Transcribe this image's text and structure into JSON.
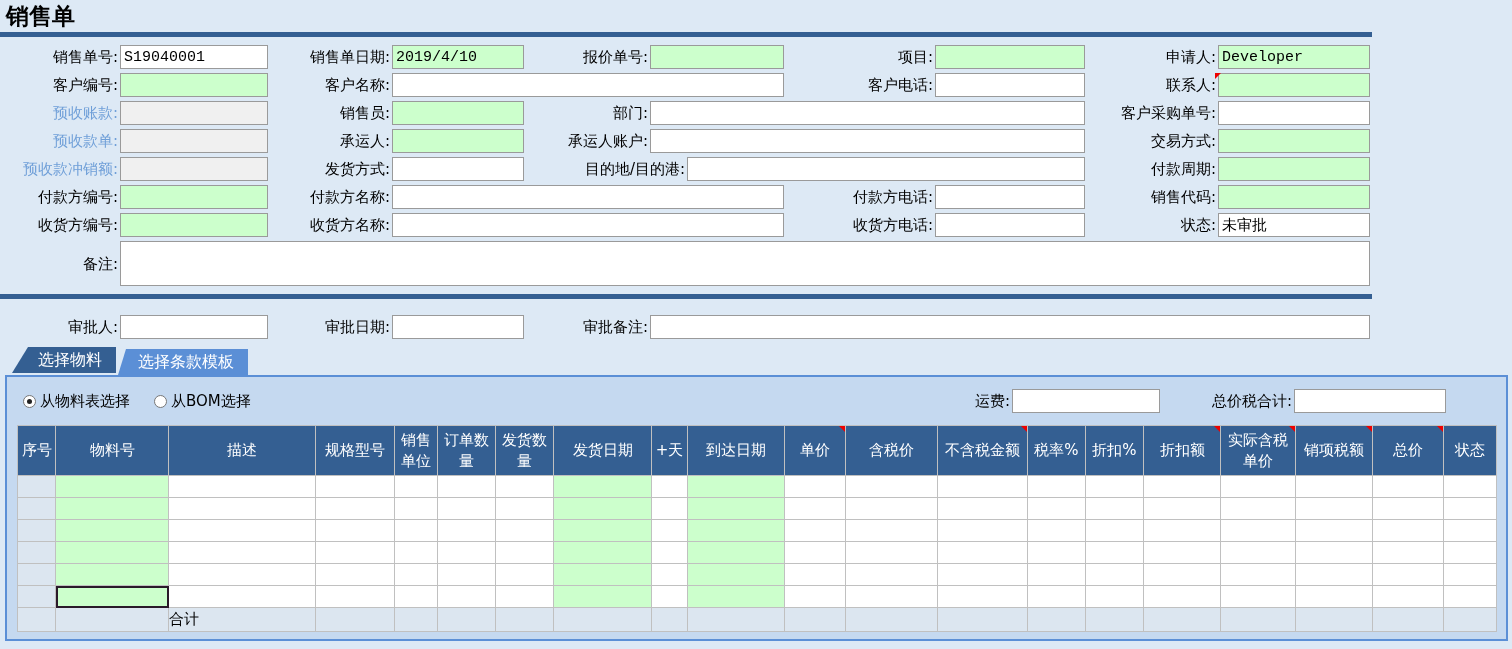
{
  "title": "销售单",
  "form": {
    "rows": [
      [
        {
          "label": "销售单号:",
          "value": "S19040001",
          "kind": "plain",
          "flag": false
        },
        {
          "label": "销售单日期:",
          "value": "2019/4/10",
          "kind": "required",
          "flag": false
        },
        {
          "label": "报价单号:",
          "kind": "required",
          "flag": false
        },
        {
          "label": "项目:",
          "kind": "required",
          "flag": false
        },
        {
          "label": "申请人:",
          "value": "Developer",
          "kind": "required",
          "flag": false
        }
      ],
      [
        {
          "label": "客户编号:",
          "kind": "required",
          "flag": false
        },
        {
          "label": "客户名称:",
          "kind": "plain",
          "flag": false
        },
        {
          "label": "客户电话:",
          "kind": "plain",
          "flag": false
        },
        {
          "label": "联系人:",
          "kind": "required",
          "flag": true
        }
      ],
      [
        {
          "label": "预收账款:",
          "kind": "readonly",
          "flag": false
        },
        {
          "label": "销售员:",
          "kind": "required",
          "flag": false
        },
        {
          "label": "部门:",
          "kind": "plain",
          "flag": false
        },
        {
          "label": "客户采购单号:",
          "kind": "plain",
          "flag": false
        }
      ],
      [
        {
          "label": "预收款单:",
          "kind": "readonly",
          "flag": false
        },
        {
          "label": "承运人:",
          "kind": "required",
          "flag": false
        },
        {
          "label": "承运人账户:",
          "kind": "plain",
          "flag": false
        },
        {
          "label": "交易方式:",
          "kind": "required",
          "flag": false
        }
      ],
      [
        {
          "label": "预收款冲销额:",
          "kind": "readonly",
          "flag": false
        },
        {
          "label": "发货方式:",
          "kind": "plain",
          "flag": false
        },
        {
          "label": "目的地/目的港:",
          "kind": "plain",
          "flag": false
        },
        {
          "label": "付款周期:",
          "kind": "required",
          "flag": false
        }
      ],
      [
        {
          "label": "付款方编号:",
          "kind": "required",
          "flag": false
        },
        {
          "label": "付款方名称:",
          "kind": "plain",
          "flag": false
        },
        {
          "label": "付款方电话:",
          "kind": "plain",
          "flag": false
        },
        {
          "label": "销售代码:",
          "kind": "required",
          "flag": false
        }
      ],
      [
        {
          "label": "收货方编号:",
          "kind": "required",
          "flag": false
        },
        {
          "label": "收货方名称:",
          "kind": "plain",
          "flag": false
        },
        {
          "label": "收货方电话:",
          "kind": "plain",
          "flag": false
        },
        {
          "label": "状态:",
          "value": "未审批",
          "kind": "plain",
          "flag": false
        }
      ],
      [
        {
          "label": "备注:",
          "kind": "multiline",
          "flag": false
        }
      ]
    ]
  },
  "approval": [
    {
      "label": "审批人:"
    },
    {
      "label": "审批日期:"
    },
    {
      "label": "审批备注:"
    }
  ],
  "tabs": [
    {
      "label": "选择物料",
      "selected": true
    },
    {
      "label": "选择条款模板",
      "selected": false
    }
  ],
  "panel": {
    "radios": [
      {
        "label": "从物料表选择",
        "selected": true
      },
      {
        "label": "从BOM选择",
        "selected": false
      }
    ],
    "fields": [
      {
        "label": "运费:"
      },
      {
        "label": "总价税合计:"
      }
    ]
  },
  "table": {
    "columns": [
      {
        "label": "序号",
        "kind": "index",
        "flag": false
      },
      {
        "label": "物料号",
        "kind": "required",
        "flag": false
      },
      {
        "label": "描述",
        "kind": "plain",
        "flag": false
      },
      {
        "label": "规格型号",
        "kind": "plain",
        "flag": false
      },
      {
        "label": "销售单位",
        "kind": "plain",
        "flag": false
      },
      {
        "label": "订单数量",
        "kind": "plain",
        "flag": false
      },
      {
        "label": "发货数量",
        "kind": "plain",
        "flag": false
      },
      {
        "label": "发货日期",
        "kind": "required",
        "flag": false
      },
      {
        "label": "+天",
        "kind": "plain",
        "flag": false
      },
      {
        "label": "到达日期",
        "kind": "required",
        "flag": false
      },
      {
        "label": "单价",
        "kind": "plain",
        "flag": true
      },
      {
        "label": "含税价",
        "kind": "plain",
        "flag": false
      },
      {
        "label": "不含税金额",
        "kind": "plain",
        "flag": true
      },
      {
        "label": "税率%",
        "kind": "plain",
        "flag": false
      },
      {
        "label": "折扣%",
        "kind": "plain",
        "flag": false
      },
      {
        "label": "折扣额",
        "kind": "plain",
        "flag": true
      },
      {
        "label": "实际含税单价",
        "kind": "plain",
        "flag": true
      },
      {
        "label": "销项税额",
        "kind": "plain",
        "flag": true
      },
      {
        "label": "总价",
        "kind": "plain",
        "flag": true
      },
      {
        "label": "状态",
        "kind": "plain",
        "flag": false
      }
    ],
    "rows": [
      {
        "focused": false
      },
      {
        "focused": false
      },
      {
        "focused": false
      },
      {
        "focused": false
      },
      {
        "focused": false
      },
      {
        "focused": true
      }
    ],
    "total_label": "合计"
  }
}
